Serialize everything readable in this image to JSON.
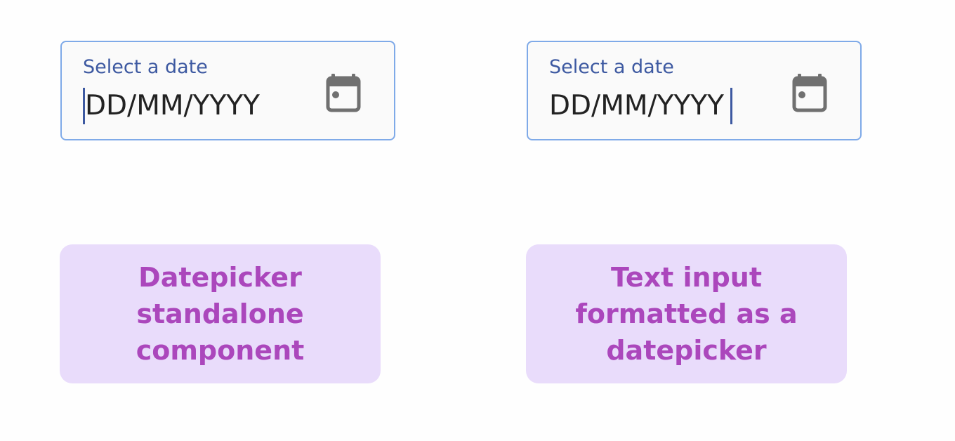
{
  "colors": {
    "field_border": "#7faae8",
    "field_background": "#fafafa",
    "label_text": "#3d59a1",
    "value_text": "#222222",
    "caret": "#3d59a1",
    "icon": "#707070",
    "note_background": "#e9dcfb",
    "note_text": "#ab47bc"
  },
  "datepicker_standalone": {
    "label": "Select a date",
    "value": "DD/MM/YYYY",
    "caret_position": "start",
    "icon": "calendar-icon",
    "note": "Datepicker\nstandalone\ncomponent"
  },
  "text_input_datepicker": {
    "label": "Select a date",
    "value": "DD/MM/YYYY",
    "caret_position": "end",
    "icon": "calendar-icon",
    "note": "Text input\nformatted as a\ndatepicker"
  }
}
